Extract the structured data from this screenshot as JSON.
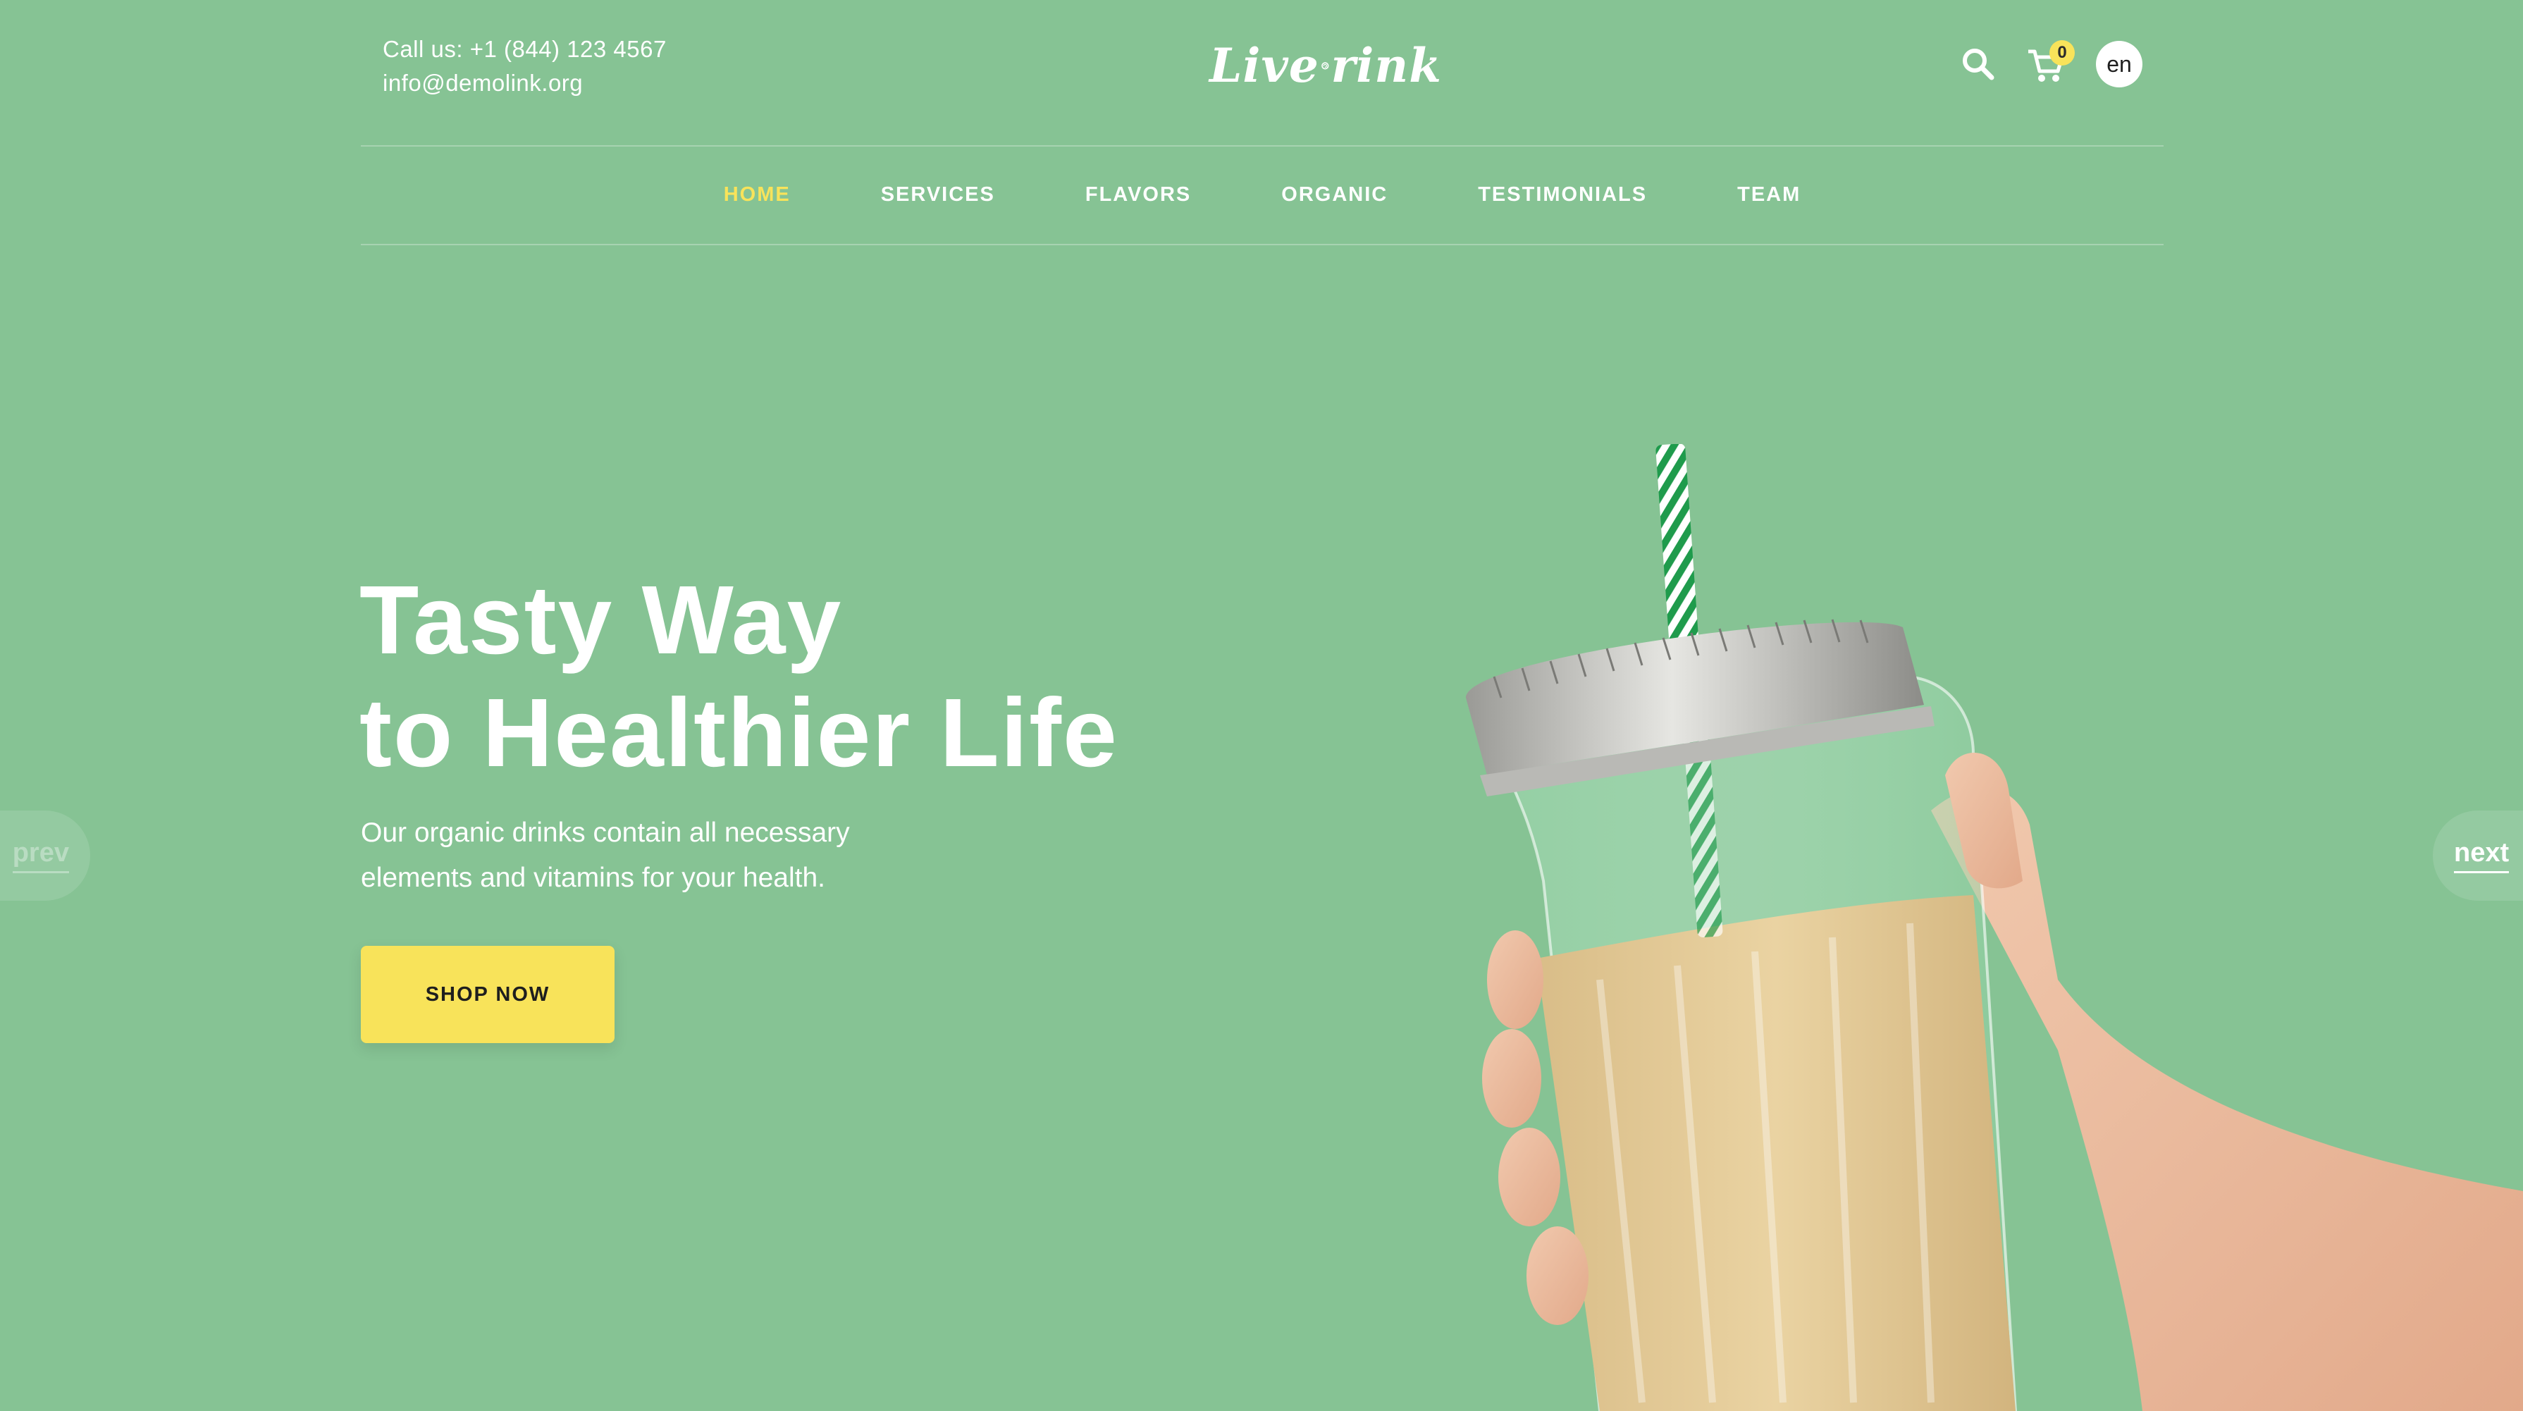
{
  "header": {
    "phone": "Call us: +1 (844) 123 4567",
    "email": "info@demolink.org",
    "logo_left": "Live",
    "logo_right": "rink",
    "cart_count": "0",
    "language": "en"
  },
  "nav": {
    "items": [
      {
        "label": "HOME",
        "active": true
      },
      {
        "label": "SERVICES"
      },
      {
        "label": "FLAVORS"
      },
      {
        "label": "ORGANIC"
      },
      {
        "label": "TESTIMONIALS"
      },
      {
        "label": "TEAM"
      }
    ]
  },
  "hero": {
    "title_line1": "Tasty Way",
    "title_line2": "to Healthier Life",
    "subtitle": "Our organic drinks contain all necessary elements and vitamins for your health.",
    "cta_label": "SHOP NOW"
  },
  "slider": {
    "prev_label": "prev",
    "next_label": "next"
  },
  "colors": {
    "background": "#86c394",
    "accent": "#f8e35a",
    "text": "#ffffff"
  }
}
